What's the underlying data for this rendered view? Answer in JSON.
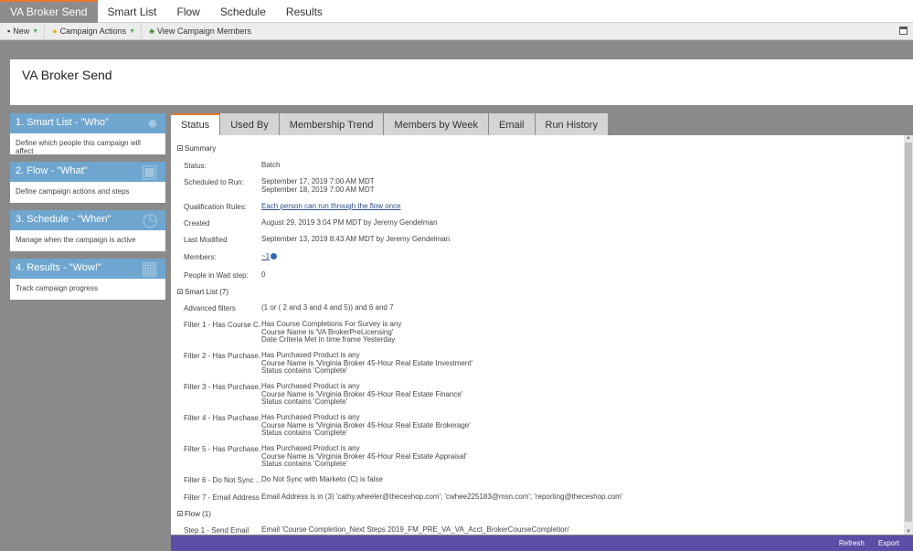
{
  "top_tabs": [
    "VA Broker Send",
    "Smart List",
    "Flow",
    "Schedule",
    "Results"
  ],
  "toolbar": {
    "new_label": "New",
    "campaign_actions_label": "Campaign Actions",
    "view_members_label": "View Campaign Members"
  },
  "header": {
    "title": "VA Broker Send"
  },
  "steps": [
    {
      "title": "1. Smart List - \"Who\"",
      "desc": "Define which people this campaign will affect"
    },
    {
      "title": "2. Flow - \"What\"",
      "desc": "Define campaign actions and steps"
    },
    {
      "title": "3. Schedule - \"When\"",
      "desc": "Manage when the campaign is active"
    },
    {
      "title": "4. Results - \"Wow!\"",
      "desc": "Track campaign progress"
    }
  ],
  "tabs": [
    "Status",
    "Used By",
    "Membership Trend",
    "Members by Week",
    "Email",
    "Run History"
  ],
  "summary": {
    "heading": "Summary",
    "status_label": "Status:",
    "status_value": "Batch",
    "scheduled_label": "Scheduled to Run:",
    "scheduled_values": [
      "September 17, 2019 7:00 AM MDT",
      "September 18, 2019 7:00 AM MDT"
    ],
    "qual_label": "Qualification Rules:",
    "qual_value": "Each person can run through the flow once",
    "created_label": "Created",
    "created_value": "August 29, 2019 3:04 PM MDT by Jeremy Gendelman",
    "modified_label": "Last Modified",
    "modified_value": "September 13, 2019 8:43 AM MDT by Jeremy Gendelman",
    "members_label": "Members:",
    "members_value": "~1",
    "wait_label": "People in Wait step:",
    "wait_value": "0"
  },
  "smart_list": {
    "heading": "Smart List (7)",
    "advanced_label": "Advanced filters",
    "advanced_value": "(1 or ( 2 and 3 and 4 and 5)) and 6 and 7",
    "filters": [
      {
        "label": "Filter 1 - Has Course C...",
        "lines": [
          "Has Course Completions For Survey is any",
          "Course Name is 'VA BrokerPreLicensing'",
          "Date Criteria Met in time frame Yesterday"
        ]
      },
      {
        "label": "Filter 2 - Has Purchase...",
        "lines": [
          "Has Purchased Product is any",
          "Course Name is 'Virginia Broker 45-Hour Real Estate Investment'",
          "Status contains 'Complete'"
        ]
      },
      {
        "label": "Filter 3 - Has Purchase...",
        "lines": [
          "Has Purchased Product is any",
          "Course Name is 'Virginia Broker 45-Hour Real Estate Finance'",
          "Status contains 'Complete'"
        ]
      },
      {
        "label": "Filter 4 - Has Purchase...",
        "lines": [
          "Has Purchased Product is any",
          "Course Name is 'Virginia Broker 45-Hour Real Estate Brokerage'",
          "Status contains 'Complete'"
        ]
      },
      {
        "label": "Filter 5 - Has Purchase...",
        "lines": [
          "Has Purchased Product is any",
          "Course Name is 'Virginia Broker 45-Hour Real Estate Appraisal'",
          "Status contains 'Complete'"
        ]
      },
      {
        "label": "Filter 6 - Do Not Sync ...",
        "lines": [
          "Do Not Sync with Marketo (C) is false"
        ]
      },
      {
        "label": "Filter 7 - Email Address",
        "lines": [
          "Email Address is in (3) 'cathy.wheeler@theceshop.com'; 'cwhee225183@msn.com'; 'reporting@theceshop.com'"
        ]
      }
    ]
  },
  "flow": {
    "heading": "Flow (1)",
    "step_label": "Step 1 - Send Email",
    "step_value": "Email 'Course Completion_Next Steps 2019_FM_PRE_VA_VA_Acct_BrokerCourseCompletion'"
  },
  "footer": {
    "refresh": "Refresh",
    "export": "Export"
  }
}
